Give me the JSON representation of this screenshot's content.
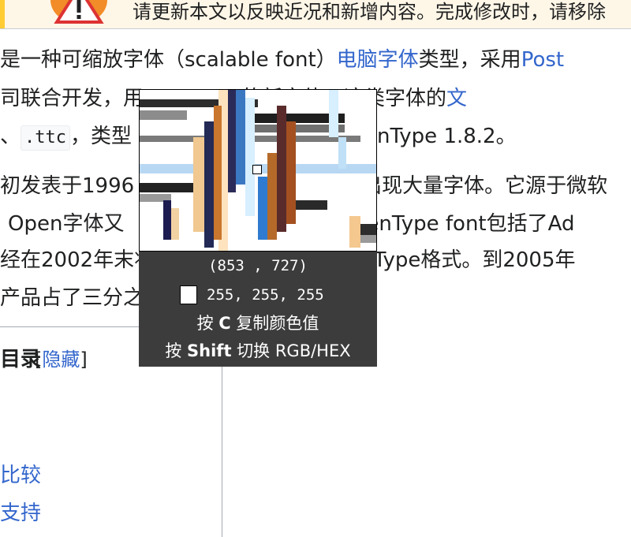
{
  "notice": {
    "text": "请更新本文以反映近况和新增内容。完成修改时，请移除"
  },
  "article": {
    "line1": {
      "a": "是一种可缩放字体（scalable font）",
      "link1": "电脑字体",
      "b": "类型，采用",
      "link2": "Post"
    },
    "line2": {
      "a": "司联合开发，用",
      "b": "的新字体。这类字体的",
      "link": "文"
    },
    "line3": {
      "a": "、",
      "code": ".ttc",
      "b": "，类型",
      "c": "准为OpenType 1.8.2。"
    },
    "line4": {
      "a": "初发表于1996",
      "b": "出现大量字体。它源于微软"
    },
    "line5": {
      "a": "Open字体又",
      "b": "OpenType font包括了Ad"
    },
    "line6": {
      "a": "经在2002年末将其字体库全部改用OpenType格式。到2005年"
    },
    "line7": {
      "a": "产品占了三分之一。"
    }
  },
  "toc": {
    "title": "目录",
    "toggle_open": "[",
    "toggle_label": "隐藏",
    "toggle_close": "]",
    "items": [
      "比较",
      "支持"
    ]
  },
  "picker": {
    "coords": "(853 , 727)",
    "rgb": "255, 255, 255",
    "swatch_color": "#ffffff",
    "hint_copy_pre": "按 ",
    "hint_copy_key": "C",
    "hint_copy_post": " 复制颜色值",
    "hint_switch_pre": "按 ",
    "hint_switch_key": "Shift",
    "hint_switch_post": " 切换 RGB/HEX"
  },
  "colors": {
    "link": "#3366cc",
    "notice_bg": "#fef6e7",
    "overlay_bg": "#3c3c3c"
  }
}
